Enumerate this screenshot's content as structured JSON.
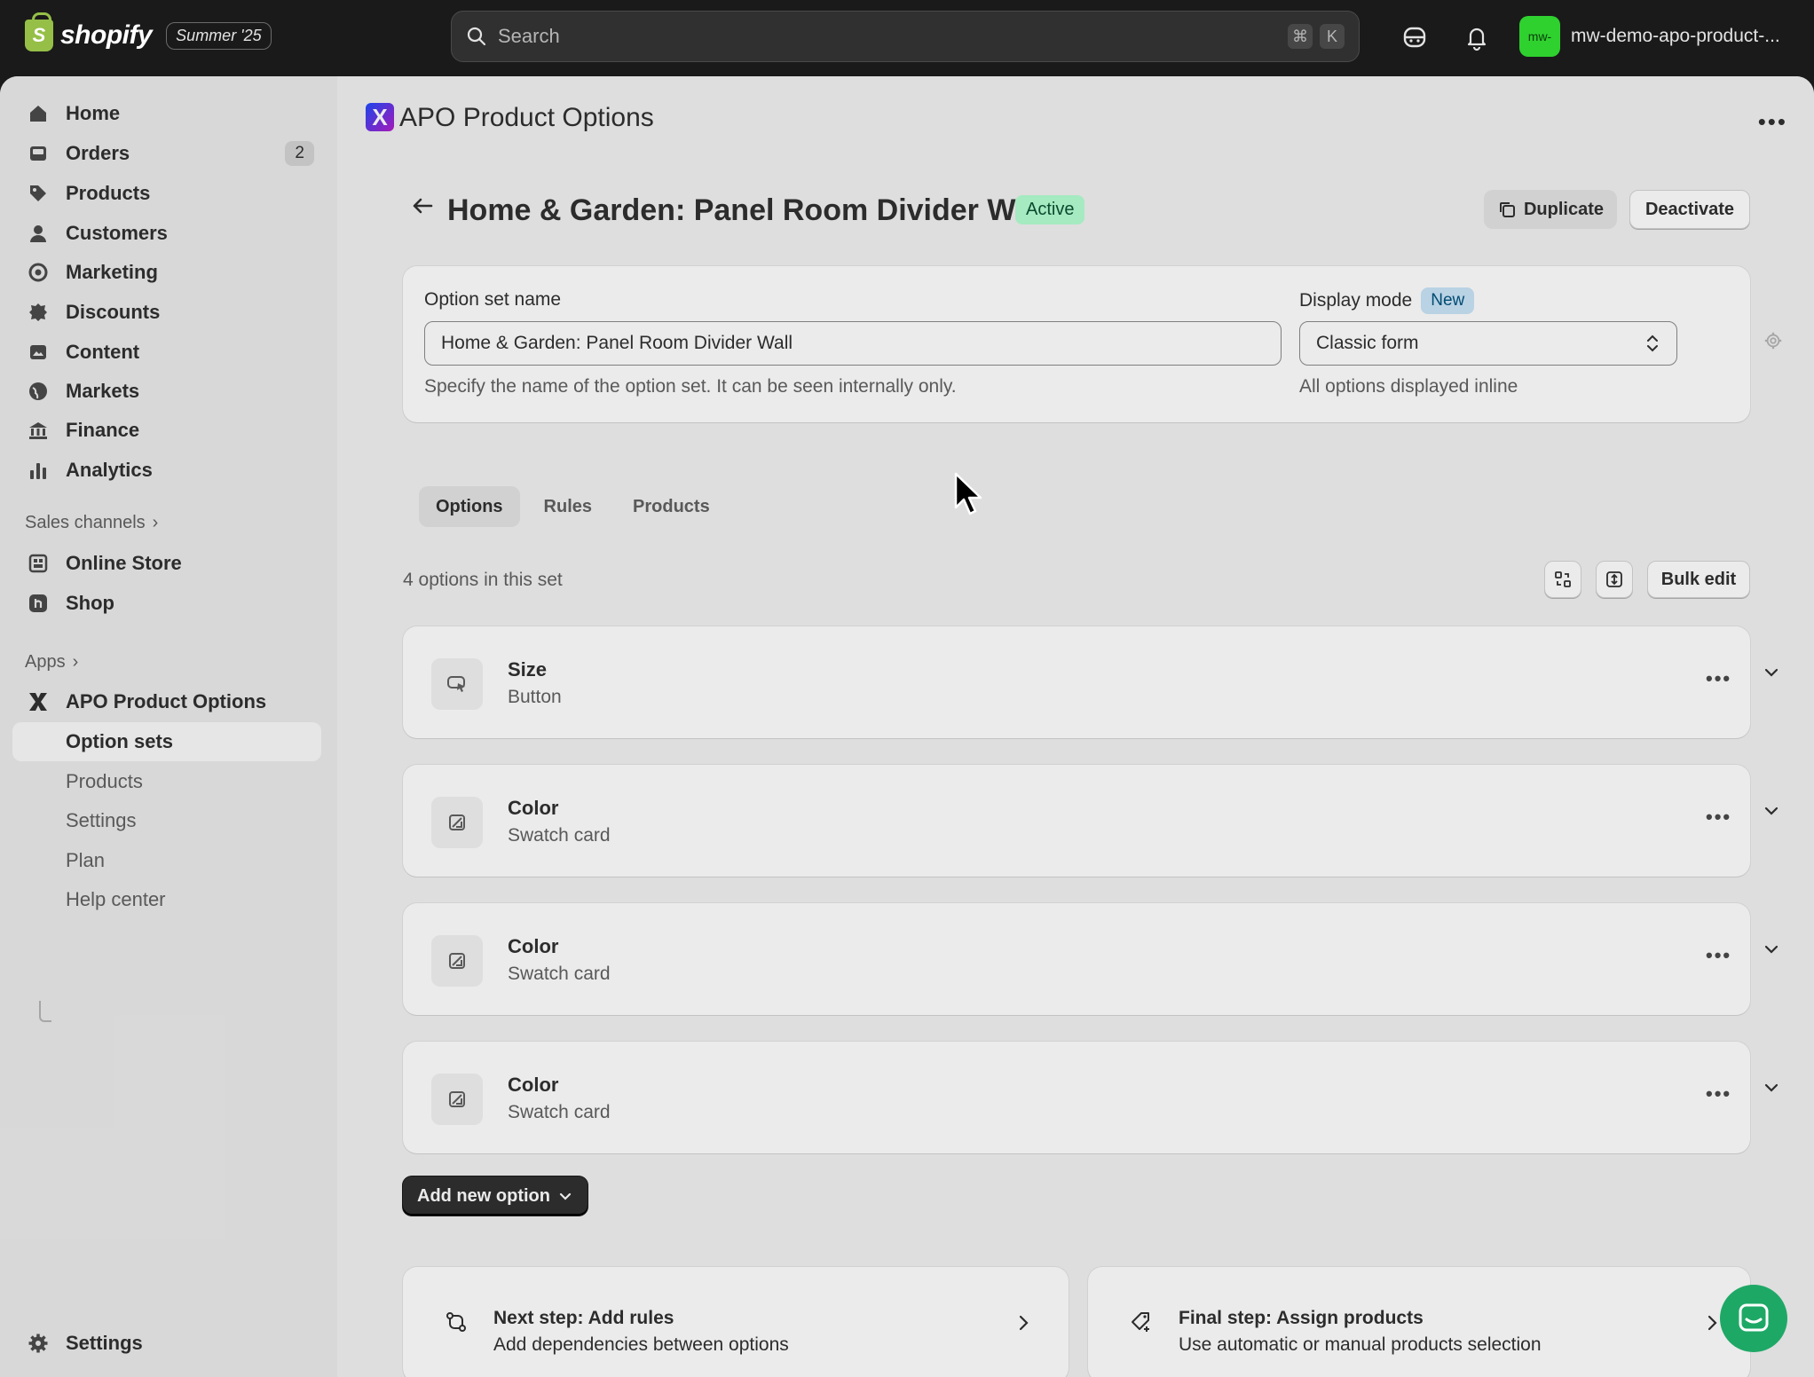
{
  "topbar": {
    "logo_text": "shopify",
    "edition": "Summer '25",
    "search_placeholder": "Search",
    "shortcut_keys": [
      "⌘",
      "K"
    ],
    "store_avatar": "mw-",
    "store_name": "mw-demo-apo-product-..."
  },
  "sidebar": {
    "items": [
      {
        "label": "Home",
        "icon": "home-icon"
      },
      {
        "label": "Orders",
        "icon": "orders-icon",
        "badge": "2"
      },
      {
        "label": "Products",
        "icon": "tag-icon"
      },
      {
        "label": "Customers",
        "icon": "person-icon"
      },
      {
        "label": "Marketing",
        "icon": "target-icon"
      },
      {
        "label": "Discounts",
        "icon": "discount-icon"
      },
      {
        "label": "Content",
        "icon": "image-icon"
      },
      {
        "label": "Markets",
        "icon": "globe-icon"
      },
      {
        "label": "Finance",
        "icon": "bank-icon"
      },
      {
        "label": "Analytics",
        "icon": "chart-icon"
      }
    ],
    "sales_channels_label": "Sales channels",
    "channels": [
      {
        "label": "Online Store",
        "icon": "store-icon"
      },
      {
        "label": "Shop",
        "icon": "shop-icon"
      }
    ],
    "apps_label": "Apps",
    "app_name": "APO Product Options",
    "app_subitems": [
      "Option sets",
      "Products",
      "Settings",
      "Plan",
      "Help center"
    ],
    "settings_label": "Settings"
  },
  "app": {
    "title": "APO Product Options",
    "logo_letter": "X"
  },
  "page": {
    "title": "Home & Garden: Panel Room Divider Wall",
    "status": "Active",
    "duplicate_label": "Duplicate",
    "deactivate_label": "Deactivate"
  },
  "form": {
    "name_label": "Option set name",
    "name_value": "Home & Garden: Panel Room Divider Wall",
    "name_help": "Specify the name of the option set. It can be seen internally only.",
    "display_mode_label": "Display mode",
    "display_mode_badge": "New",
    "display_mode_value": "Classic form",
    "display_mode_help": "All options displayed inline"
  },
  "tabs": [
    "Options",
    "Rules",
    "Products"
  ],
  "options_count_text": "4 options in this set",
  "bulk_edit_label": "Bulk edit",
  "options": [
    {
      "name": "Size",
      "type": "Button",
      "icon": "cursor-click-icon"
    },
    {
      "name": "Color",
      "type": "Swatch card",
      "icon": "swatch-icon"
    },
    {
      "name": "Color",
      "type": "Swatch card",
      "icon": "swatch-icon"
    },
    {
      "name": "Color",
      "type": "Swatch card",
      "icon": "swatch-icon"
    }
  ],
  "add_option_label": "Add new option",
  "steps": [
    {
      "title": "Next step: Add rules",
      "desc": "Add dependencies between options",
      "icon": "rules-icon"
    },
    {
      "title": "Final step: Assign products",
      "desc": "Use automatic or manual products selection",
      "icon": "tag-plus-icon"
    }
  ],
  "colors": {
    "topbar": "#1a1a1a",
    "active_badge": "#b4fed2",
    "new_badge": "#c9e4f8",
    "chat": "#1ea866",
    "store_avatar": "#2fd12f"
  }
}
